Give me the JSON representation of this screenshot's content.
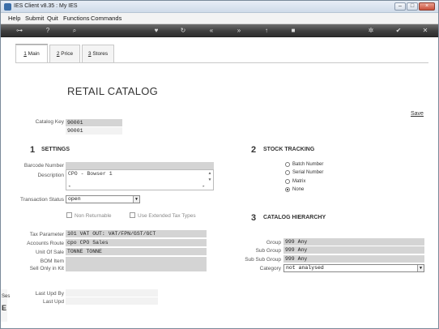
{
  "window": {
    "title": "IES Client v8.35 : My IES",
    "controls": {
      "minimize": "–",
      "maximize": "□",
      "close": "×"
    }
  },
  "menubar": {
    "items": [
      "Help",
      "Submit",
      "Quit",
      "Functions",
      "Commands"
    ]
  },
  "toolbar": {
    "icons": [
      "key-icon",
      "help-icon",
      "search-icon",
      "favorite-icon",
      "refresh-icon",
      "rewind-icon",
      "forward-icon",
      "upload-icon",
      "stop-icon",
      "settings-icon",
      "check-icon",
      "close-icon"
    ]
  },
  "tabs": [
    {
      "key": "1",
      "label": " Main"
    },
    {
      "key": "2",
      "label": " Price"
    },
    {
      "key": "3",
      "label": " Stores"
    }
  ],
  "page": {
    "heading": "RETAIL CATALOG",
    "save_link": "Save"
  },
  "catalog": {
    "key_label": "Catalog Key",
    "key_value": "90001",
    "key_value_2": "90001"
  },
  "settings": {
    "number": "1",
    "title": "SETTINGS",
    "barcode_label": "Barcode Number",
    "barcode_value": "",
    "description_label": "Description",
    "description_value": "CPO - Bowser 1",
    "transaction_status_label": "Transaction Status",
    "transaction_status_value": "open",
    "non_returnable_label": "Non Returnable",
    "non_returnable_checked": false,
    "extended_tax_label": "Use Extended Tax Types",
    "extended_tax_checked": false,
    "tax_parameter_label": "Tax Parameter",
    "tax_parameter_value": "101 VAT OUT: VAT/FPN/GST/GCT",
    "accounts_route_label": "Accounts Route",
    "accounts_route_value": "cpo CPO Sales",
    "unit_of_sale_label": "Unit Of Sale",
    "unit_of_sale_value": "TONNE TONNE",
    "bom_item_label": "BOM Item",
    "bom_item_value": "",
    "sell_only_label": "Sell Only in Kit",
    "sell_only_value": ""
  },
  "stock_tracking": {
    "number": "2",
    "title": "STOCK TRACKING",
    "options": [
      "Batch Number",
      "Serial Number",
      "Matrix",
      "None"
    ],
    "selected": "None"
  },
  "catalog_hierarchy": {
    "number": "3",
    "title": "CATALOG HIERARCHY",
    "group_label": "Group",
    "group_value": "999 Any",
    "sub_group_label": "Sub Group",
    "sub_group_value": "999 Any",
    "sub_sub_group_label": "Sub Sub Group",
    "sub_sub_group_value": "999 Any",
    "category_label": "Category",
    "category_value": "not analysed"
  },
  "audit": {
    "last_upd_by_label": "Last Upd By",
    "last_upd_by_value": "",
    "last_upd_label": "Last Upd",
    "last_upd_value": ""
  },
  "left_edge": {
    "text_1": "Ses",
    "text_2": "E"
  }
}
